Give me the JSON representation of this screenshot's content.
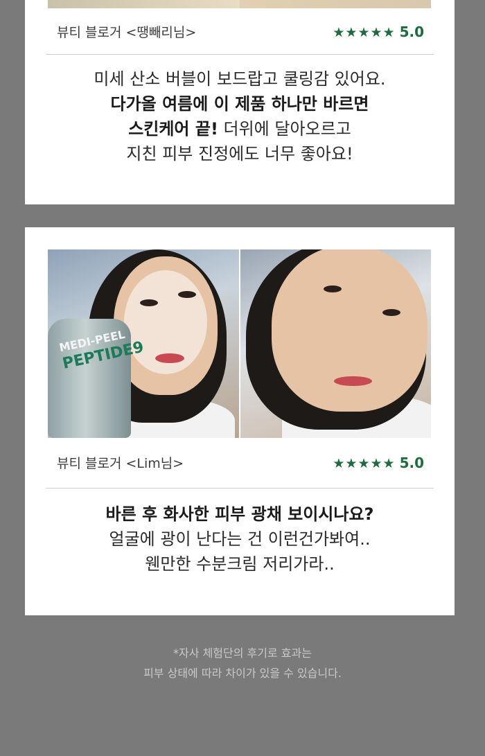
{
  "reviews": [
    {
      "author": "뷰티 블로거 <땡빼리님>",
      "stars": "★★★★★",
      "score": "5.0",
      "lines": [
        [
          {
            "text": "미세 산소 버블이 보드랍고 쿨링감 있어요.",
            "bold": false
          }
        ],
        [
          {
            "text": "다가올 여름에 이 제품 하나만 바르면",
            "bold": true
          }
        ],
        [
          {
            "text": "스킨케어 끝!",
            "bold": true
          },
          {
            "text": " 더위에 달아오르고",
            "bold": false
          }
        ],
        [
          {
            "text": "지친 피부 진정에도 너무 좋아요!",
            "bold": false
          }
        ]
      ]
    },
    {
      "author": "뷰티 블로거 <Lim님>",
      "stars": "★★★★★",
      "score": "5.0",
      "product_label": {
        "brand": "MEDI-PEEL",
        "name": "PEPTIDE9"
      },
      "lines": [
        [
          {
            "text": "바른 후 화사한 피부 광채 보이시나요?",
            "bold": true
          }
        ],
        [
          {
            "text": "얼굴에 광이 난다는 건 이런건가봐여..",
            "bold": false
          }
        ],
        [
          {
            "text": "웬만한 수분크림 저리가라..",
            "bold": false
          }
        ]
      ]
    }
  ],
  "disclaimer": {
    "line1": "*자사 체험단의 후기로 효과는",
    "line2": "피부 상태에 따라 차이가 있을 수 있습니다."
  },
  "colors": {
    "page_bg": "#7a7a7a",
    "card_bg": "#ffffff",
    "rating_green": "#1f6b3f",
    "disclaimer_text": "#c9c9c9"
  }
}
